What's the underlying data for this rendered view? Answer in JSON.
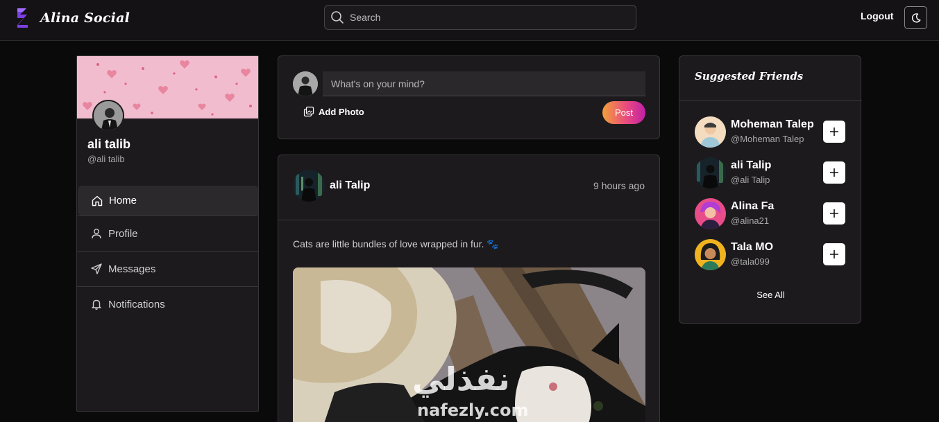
{
  "app": {
    "brand_name": "Alina Social",
    "accent_color": "#7b3fe4"
  },
  "header": {
    "search_placeholder": "Search",
    "logout_label": "Logout",
    "theme_icon": "moon-icon"
  },
  "profile": {
    "name": "ali talib",
    "handle": "@ali talib"
  },
  "nav": {
    "items": [
      {
        "label": "Home",
        "icon": "home-icon",
        "active": true
      },
      {
        "label": "Profile",
        "icon": "user-icon",
        "active": false
      },
      {
        "label": "Messages",
        "icon": "send-icon",
        "active": false
      },
      {
        "label": "Notifications",
        "icon": "bell-icon",
        "active": false
      }
    ]
  },
  "composer": {
    "placeholder": "What's on your mind?",
    "add_photo_label": "Add Photo",
    "post_label": "Post"
  },
  "post": {
    "author": "ali Talip",
    "time": "9 hours ago",
    "text": "Cats are little bundles of love wrapped in fur. 🐾"
  },
  "watermark": {
    "arabic": "نفذلي",
    "latin": "nafezly.com"
  },
  "suggested": {
    "title": "Suggested Friends",
    "friends": [
      {
        "name": "Moheman Talep",
        "handle": "@Moheman Talep"
      },
      {
        "name": "ali Talip",
        "handle": "@ali Talip"
      },
      {
        "name": "Alina Fa",
        "handle": "@alina21"
      },
      {
        "name": "Tala MO",
        "handle": "@tala099"
      }
    ],
    "see_all_label": "See All"
  }
}
